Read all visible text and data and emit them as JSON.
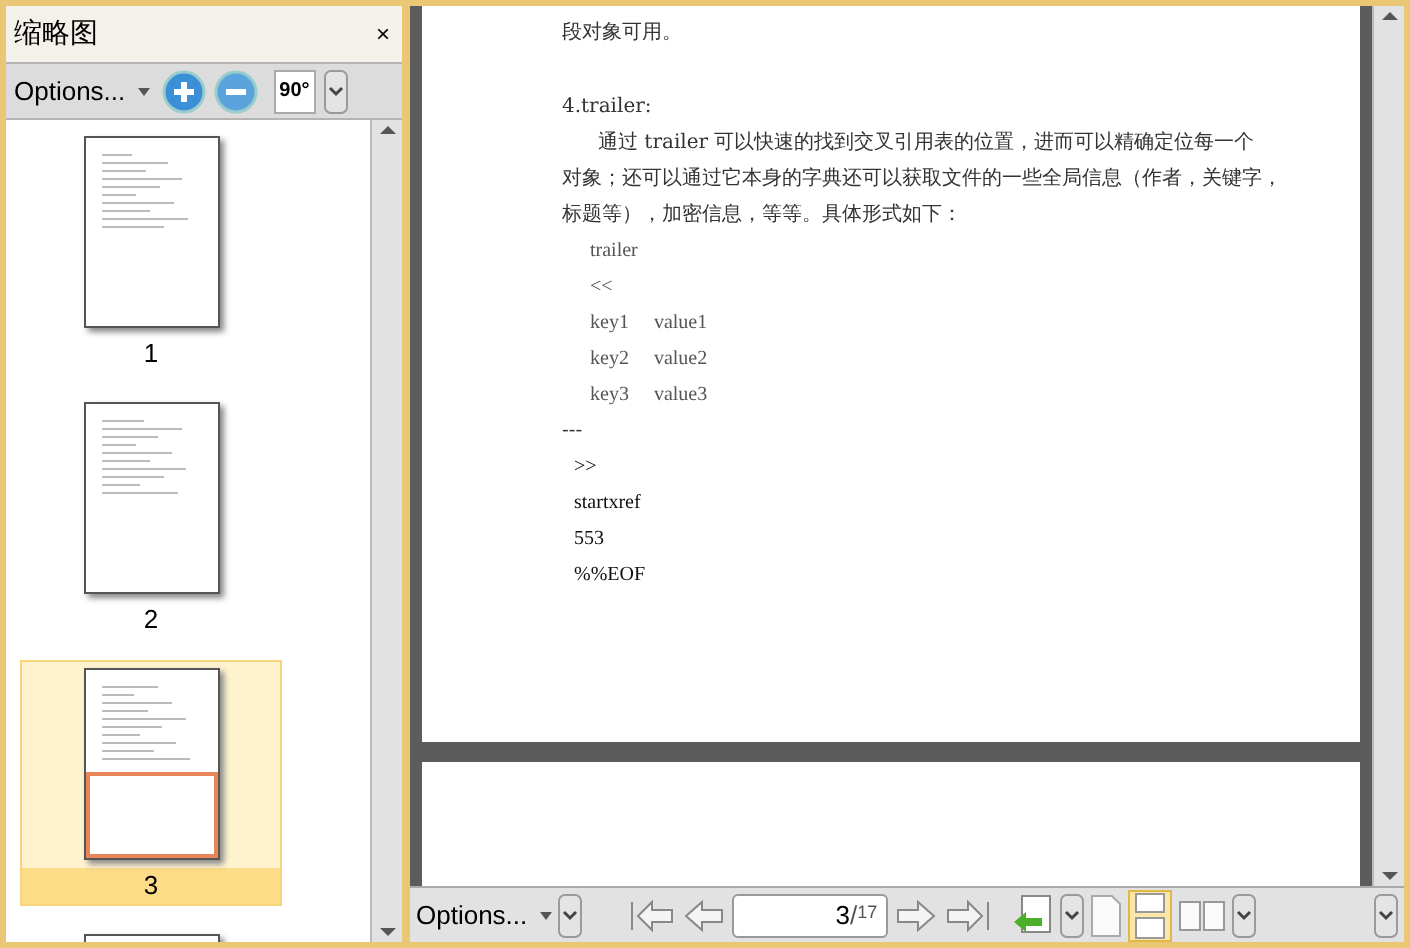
{
  "panel": {
    "title": "缩略图",
    "close": "×",
    "options": "Options...",
    "rotate": "90°"
  },
  "thumbnails": [
    {
      "label": "1",
      "selected": false
    },
    {
      "label": "2",
      "selected": false
    },
    {
      "label": "3",
      "selected": true
    },
    {
      "selected": false
    }
  ],
  "document": {
    "lines": [
      {
        "kind": "text",
        "text": "段对象可用。"
      },
      {
        "kind": "gap"
      },
      {
        "kind": "text",
        "text": "4.trailer:"
      },
      {
        "kind": "indent",
        "text": "通过 trailer 可以快速的找到交叉引用表的位置，进而可以精确定位每一个"
      },
      {
        "kind": "text",
        "text": "对象；还可以通过它本身的字典还可以获取文件的一些全局信息（作者，关键字，"
      },
      {
        "kind": "text",
        "text": "标题等），加密信息，等等。具体形式如下："
      },
      {
        "kind": "code",
        "text": "trailer"
      },
      {
        "kind": "code",
        "text": "<<"
      },
      {
        "kind": "code",
        "text": "key1     value1"
      },
      {
        "kind": "code",
        "text": "key2     value2"
      },
      {
        "kind": "code",
        "text": "key3     value3"
      },
      {
        "kind": "text",
        "text": "---"
      },
      {
        "kind": "plain",
        "text": ">>"
      },
      {
        "kind": "plain",
        "text": "startxref"
      },
      {
        "kind": "plain",
        "text": "553"
      },
      {
        "kind": "plain",
        "text": "%%EOF"
      }
    ]
  },
  "bottom_toolbar": {
    "options": "Options...",
    "page_value": "3",
    "separator": "/",
    "page_total": "17"
  }
}
